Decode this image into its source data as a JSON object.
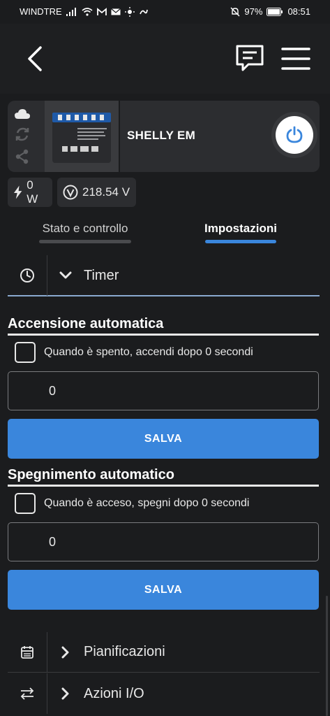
{
  "status_bar": {
    "carrier": "WINDTRE",
    "battery": "97%",
    "time": "08:51"
  },
  "device": {
    "name": "SHELLY EM"
  },
  "metrics": {
    "power": "0 W",
    "voltage": "218.54 V"
  },
  "tabs": [
    {
      "label": "Stato e controllo",
      "active": false
    },
    {
      "label": "Impostazioni",
      "active": true
    }
  ],
  "timer_section": {
    "title": "Timer"
  },
  "auto_on": {
    "heading": "Accensione automatica",
    "checkbox_label": "Quando è spento, accendi dopo 0 secondi",
    "value": "0",
    "save_label": "SALVA"
  },
  "auto_off": {
    "heading": "Spegnimento automatico",
    "checkbox_label": "Quando è acceso, spegni dopo 0 secondi",
    "value": "0",
    "save_label": "SALVA"
  },
  "sections": [
    {
      "title": "Pianificazioni",
      "icon": "calendar-icon"
    },
    {
      "title": "Azioni I/O",
      "icon": "swap-arrows-icon"
    }
  ],
  "colors": {
    "accent": "#3a86dc",
    "background": "#1b1c1e",
    "card": "#2c2d30"
  }
}
